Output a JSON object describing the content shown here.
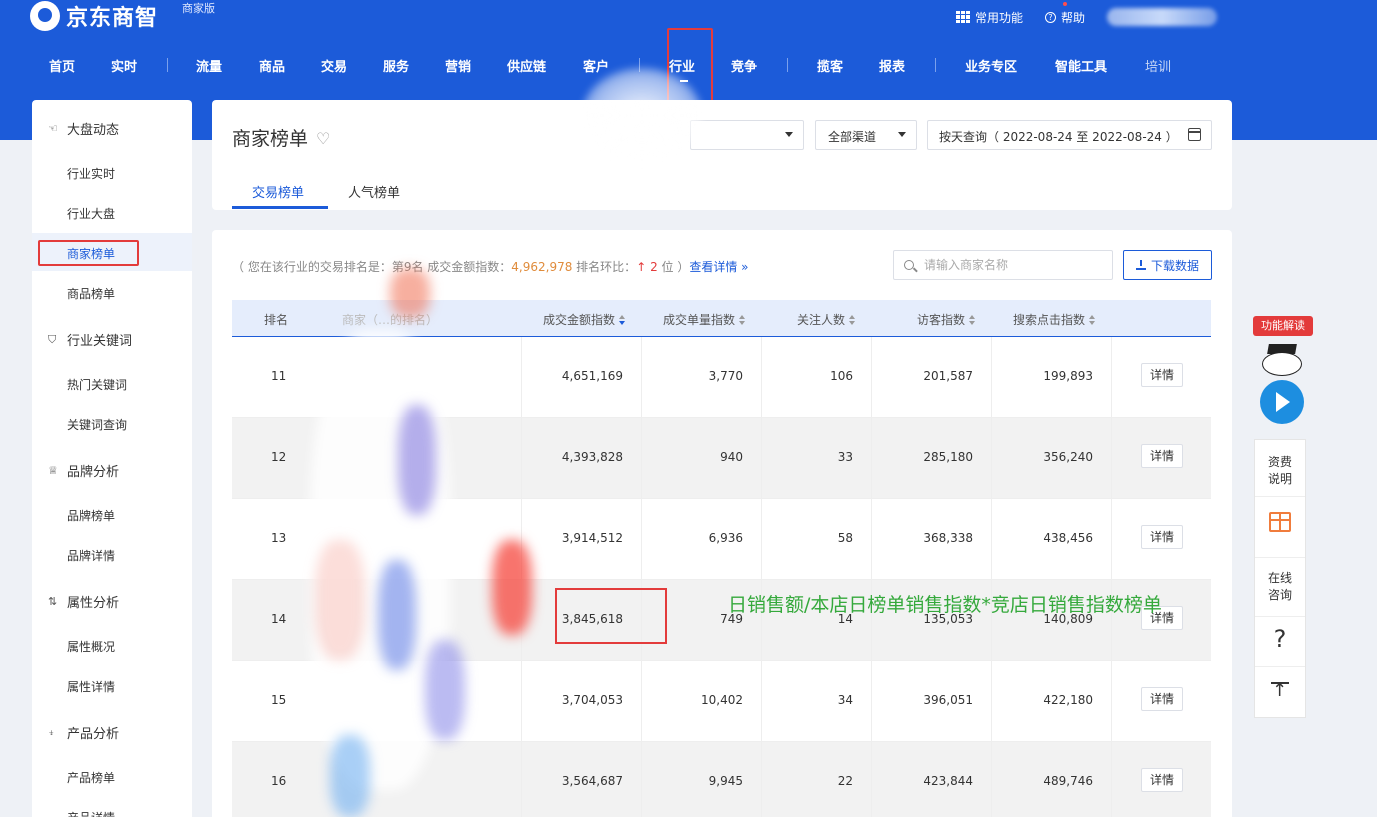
{
  "brand": {
    "name": "京东商智",
    "edition": "商家版"
  },
  "top_links": {
    "common": "常用功能",
    "help": "帮助"
  },
  "nav": [
    {
      "label": "首页"
    },
    {
      "label": "实时"
    },
    {
      "label": "流量"
    },
    {
      "label": "商品"
    },
    {
      "label": "交易"
    },
    {
      "label": "服务"
    },
    {
      "label": "营销"
    },
    {
      "label": "供应链"
    },
    {
      "label": "客户"
    },
    {
      "label": "行业"
    },
    {
      "label": "竞争"
    },
    {
      "label": "揽客"
    },
    {
      "label": "报表"
    },
    {
      "label": "业务专区"
    },
    {
      "label": "智能工具"
    },
    {
      "label": "培训"
    }
  ],
  "sidebar": {
    "groups": [
      {
        "title": "大盘动态",
        "icon": "hand-icon",
        "items": [
          "行业实时",
          "行业大盘",
          "商家榜单",
          "商品榜单"
        ]
      },
      {
        "title": "行业关键词",
        "icon": "shield-icon",
        "items": [
          "热门关键词",
          "关键词查询"
        ]
      },
      {
        "title": "品牌分析",
        "icon": "crown-icon",
        "items": [
          "品牌榜单",
          "品牌详情"
        ]
      },
      {
        "title": "属性分析",
        "icon": "sort-icon",
        "items": [
          "属性概况",
          "属性详情"
        ]
      },
      {
        "title": "产品分析",
        "icon": "basket-icon",
        "items": [
          "产品榜单",
          "产品详情"
        ]
      }
    ],
    "active_item": "商家榜单"
  },
  "header": {
    "title": "商家榜单",
    "channel_select": "全部渠道",
    "date_range": "按天查询（ 2022-08-24 至 2022-08-24 ）",
    "tabs": [
      "交易榜单",
      "人气榜单"
    ],
    "active_tab": "交易榜单"
  },
  "summary": {
    "prefix": "（ 您在该行业的交易排名是：第9名  成交金额指数：",
    "amount": "4,962,978",
    "mid": "  排名环比：",
    "change": "2",
    "suffix": " 位 ）",
    "link": "查看详情 »"
  },
  "search": {
    "placeholder": "请输入商家名称"
  },
  "download_label": "下载数据",
  "table": {
    "headers": [
      "排名",
      "商家（…的排名）",
      "成交金额指数",
      "成交单量指数",
      "关注人数",
      "访客指数",
      "搜索点击指数"
    ],
    "detail_label": "详情",
    "rows": [
      {
        "rank": "11",
        "amount": "4,651,169",
        "orders": "3,770",
        "follows": "106",
        "visitors": "201,587",
        "clicks": "199,893"
      },
      {
        "rank": "12",
        "amount": "4,393,828",
        "orders": "940",
        "follows": "33",
        "visitors": "285,180",
        "clicks": "356,240"
      },
      {
        "rank": "13",
        "amount": "3,914,512",
        "orders": "6,936",
        "follows": "58",
        "visitors": "368,338",
        "clicks": "438,456"
      },
      {
        "rank": "14",
        "amount": "3,845,618",
        "orders": "749",
        "follows": "14",
        "visitors": "135,053",
        "clicks": "140,809"
      },
      {
        "rank": "15",
        "amount": "3,704,053",
        "orders": "10,402",
        "follows": "34",
        "visitors": "396,051",
        "clicks": "422,180"
      },
      {
        "rank": "16",
        "amount": "3,564,687",
        "orders": "9,945",
        "follows": "22",
        "visitors": "423,844",
        "clicks": "489,746"
      }
    ]
  },
  "annotation": "日销售额/本店日榜单销售指数*竞店日销售指数榜单",
  "float_panel": {
    "badge": "功能解读",
    "fee": "资费说明",
    "consult": "在线咨询",
    "question": "?"
  },
  "colors": {
    "brand_blue": "#1c5bd9",
    "highlight_red": "#e33b3b",
    "annotation_green": "#35a93c"
  }
}
